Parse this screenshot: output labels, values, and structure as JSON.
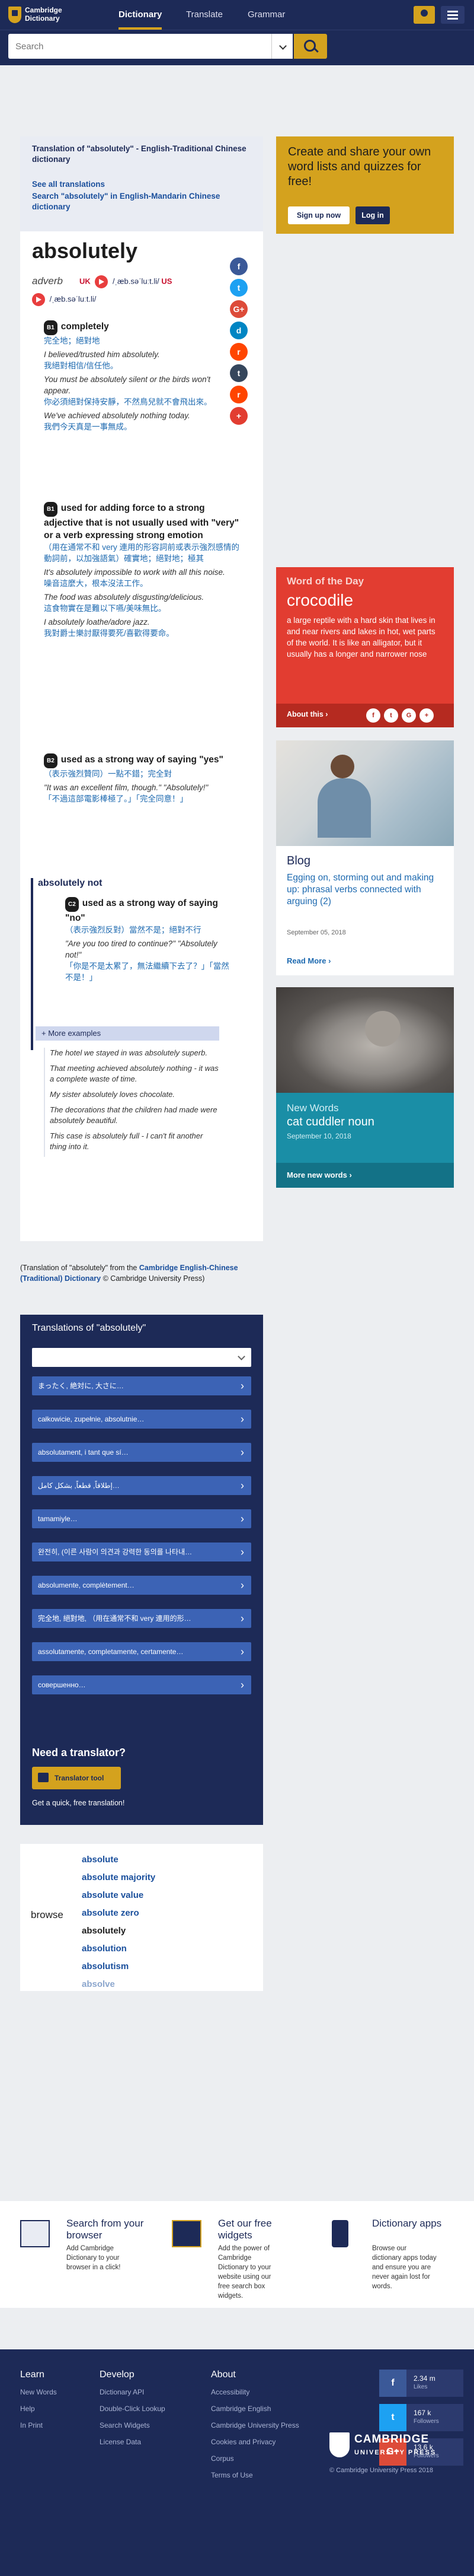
{
  "header": {
    "logo_line1": "Cambridge",
    "logo_line2": "Dictionary",
    "tabs": [
      "Dictionary",
      "Translate",
      "Grammar"
    ]
  },
  "search": {
    "placeholder": "Search"
  },
  "entry": {
    "translation_heading": "Translation of \"absolutely\" - English-Traditional Chinese dictionary",
    "links": [
      "See all translations",
      "Search \"absolutely\" in English-Mandarin Chinese dictionary"
    ],
    "headword": "absolutely",
    "pos": "adverb",
    "uk_label": "UK",
    "uk_ipa": "/ˌæb.səˈluːt.li/",
    "us_label": "US",
    "us_ipa": "/ˌæb.səˈluːt.li/",
    "senses": [
      {
        "level": "B1",
        "definition": "completely",
        "cn_def": "完全地；絕對地",
        "examples": [
          {
            "en": "I believed/trusted him absolutely.",
            "zh": "我絕對相信/信任他。"
          },
          {
            "en": "You must be absolutely silent or the birds won't appear.",
            "zh": "你必須絕對保持安靜，不然鳥兒就不會飛出來。"
          },
          {
            "en": "We've achieved absolutely nothing today.",
            "zh": "我們今天真是一事無成。"
          }
        ]
      },
      {
        "level": "B1",
        "definition": "used for adding force to a strong adjective that is not usually used with \"very\" or a verb expressing strong emotion",
        "cn_def": "（用在通常不和 very 連用的形容詞前或表示強烈感情的動詞前，以加強語氣）確實地；絕對地；極其",
        "examples": [
          {
            "en": "It's absolutely impossible to work with all this noise.",
            "zh": "噪音這麼大，根本沒法工作。"
          },
          {
            "en": "The food was absolutely disgusting/delicious.",
            "zh": "這食物實在是難以下嚥/美味無比。"
          },
          {
            "en": "I absolutely loathe/adore jazz.",
            "zh": "我對爵士樂討厭得要死/喜歡得要命。"
          }
        ]
      },
      {
        "level": "B2",
        "definition": "used as a strong way of saying \"yes\"",
        "cn_def": "（表示強烈贊同）一點不錯；完全對",
        "examples": [
          {
            "en": "\"It was an excellent film, though.\" \"Absolutely!\"",
            "zh": "「不過這部電影棒極了。」「完全同意！」"
          }
        ]
      }
    ],
    "phrase": {
      "title": "absolutely not",
      "level": "C2",
      "definition": "used as a strong way of saying \"no\"",
      "cn_def": "（表示強烈反對）當然不是；絕對不行",
      "examples": [
        {
          "en": "\"Are you too tired to continue?\" \"Absolutely not!\"",
          "zh": "「你是不是太累了，無法繼續下去了？」「當然不是！」"
        }
      ]
    },
    "more_examples_label": "More examples",
    "more_examples": [
      "The hotel we stayed in was absolutely superb.",
      "That meeting achieved absolutely nothing - it was a complete waste of time.",
      "My sister absolutely loves chocolate.",
      "The decorations that the children had made were absolutely beautiful.",
      "This case is absolutely full - I can't fit another thing into it."
    ],
    "source_prefix": "(Translation of \"absolutely\" from the ",
    "source_link": "Cambridge English-Chinese (Traditional) Dictionary",
    "source_suffix": " © Cambridge University Press)"
  },
  "translations": {
    "title": "Translations of \"absolutely\"",
    "items": [
      "まったく, 絶対に, 大さに…",
      "całkowicie, zupełnie, absolutnie…",
      "absolutament, i tant que sí…",
      "إطلاقاً, قطعاً, بشكل كامل…",
      "tamamiyle…",
      "완전히, (이른 사람이 의견과 강력한 동의를 나타내…",
      "absolumente, complètement…",
      "完全地, 絕對地, （用在通常不和 very 連用的形…",
      "assolutamente, completamente, certamente…",
      "совершенно…"
    ],
    "need_title": "Need a translator?",
    "tool_label": "Translator tool",
    "quick_label": "Get a quick, free translation!"
  },
  "browse": {
    "label": "browse",
    "items": [
      "absolute",
      "absolute majority",
      "absolute value",
      "absolute zero",
      "absolutely",
      "absolution",
      "absolutism",
      "absolve"
    ]
  },
  "sidebar": {
    "create_text": "Create and share your own word lists and quizzes for free!",
    "signup": "Sign up now",
    "login": "Log in",
    "wotd_label": "Word of the Day",
    "wotd_word": "crocodile",
    "wotd_def": "a large reptile with a hard skin that lives in and near rivers and lakes in hot, wet parts of the world. It is like an alligator, but it usually has a longer and narrower nose",
    "wotd_about": "About this",
    "blog_label": "Blog",
    "blog_title": "Egging on, storming out and making up: phrasal verbs connected with arguing (2)",
    "blog_date": "September 05, 2018",
    "blog_more": "Read More",
    "nw_label": "New Words",
    "nw_word": "cat cuddler noun",
    "nw_date": "September 10, 2018",
    "nw_more": "More new words"
  },
  "promo": [
    {
      "title": "Search from your browser",
      "text": "Add Cambridge Dictionary to your browser in a click!"
    },
    {
      "title": "Get our free widgets",
      "text": "Add the power of Cambridge Dictionary to your website using our free search box widgets."
    },
    {
      "title": "Dictionary apps",
      "text": "Browse our dictionary apps today and ensure you are never again lost for words."
    }
  ],
  "footer": {
    "learn_title": "Learn",
    "learn_links": [
      "New Words",
      "Help",
      "In Print"
    ],
    "develop_title": "Develop",
    "develop_links": [
      "Dictionary API",
      "Double-Click Lookup",
      "Search Widgets",
      "License Data"
    ],
    "about_title": "About",
    "about_links": [
      "Accessibility",
      "Cambridge English",
      "Cambridge University Press",
      "Cookies and Privacy",
      "Corpus",
      "Terms of Use"
    ],
    "social": [
      {
        "icon": "f",
        "count": "2.34 m",
        "label": "Likes"
      },
      {
        "icon": "t",
        "count": "167 k",
        "label": "Followers"
      },
      {
        "icon": "G+",
        "count": "13.6 k",
        "label": "Followers"
      }
    ],
    "cup_line1": "CAMBRIDGE",
    "cup_line2": "UNIVERSITY PRESS",
    "copyright": "© Cambridge University Press 2018"
  }
}
